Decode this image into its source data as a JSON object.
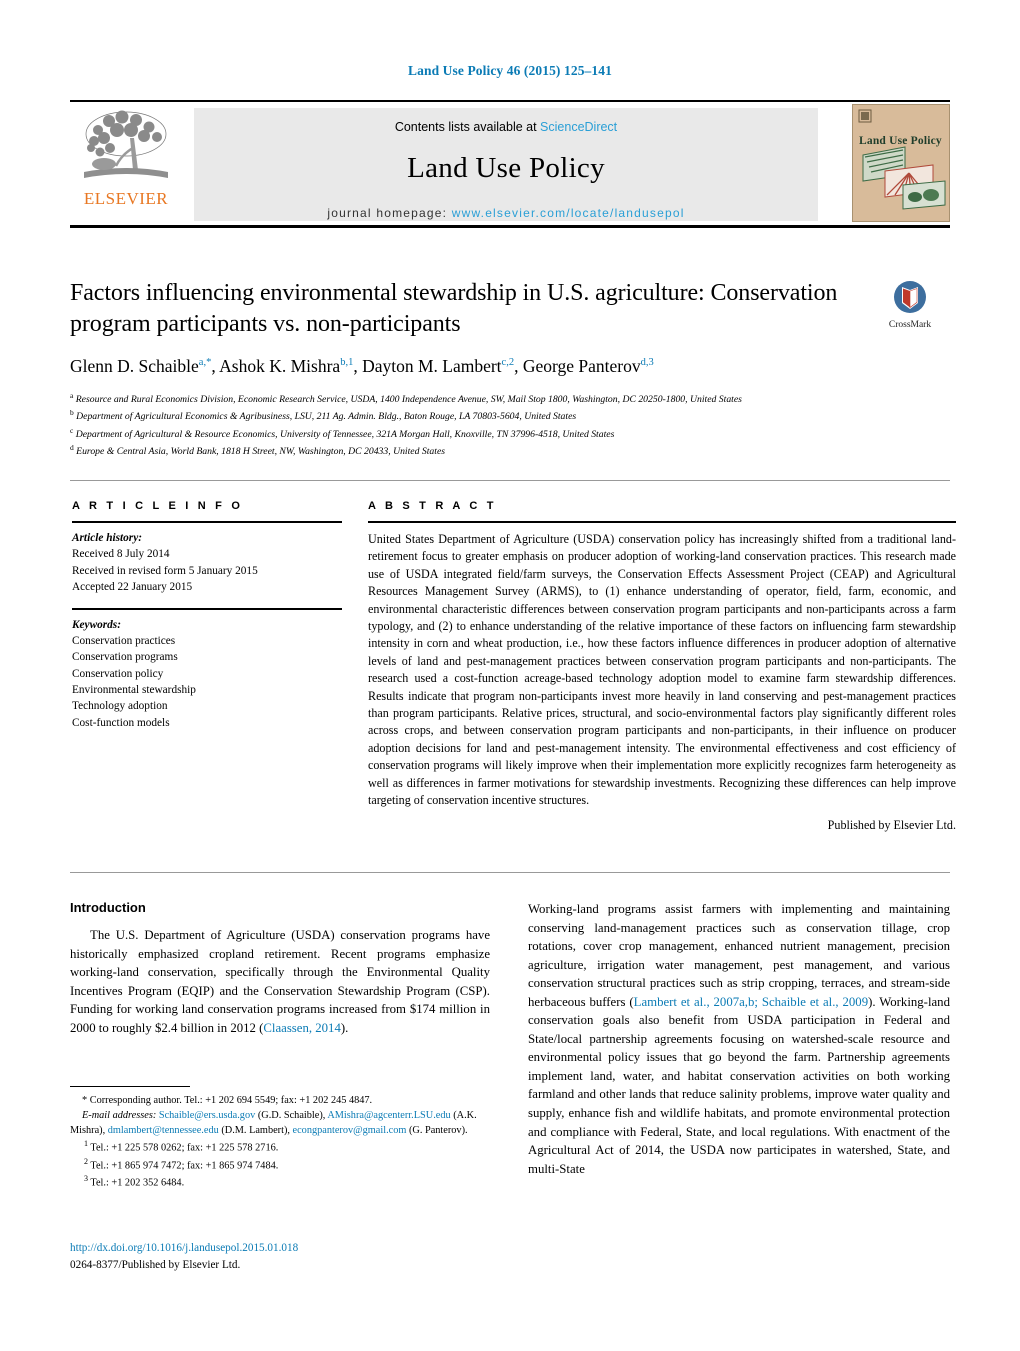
{
  "journal_ref": "Land Use Policy 46 (2015) 125–141",
  "masthead": {
    "contents_prefix": "Contents lists available at ",
    "sciencedirect": "ScienceDirect",
    "journal_title": "Land Use Policy",
    "homepage_prefix": "journal homepage:",
    "homepage_url": "www.elsevier.com/locate/landusepol",
    "publisher_wordmark": "ELSEVIER",
    "cover_title": "Land Use Policy"
  },
  "article": {
    "title": "Factors influencing environmental stewardship in U.S. agriculture: Conservation program participants vs. non-participants",
    "crossmark_label": "CrossMark",
    "authors": [
      {
        "name": "Glenn D. Schaible",
        "marks": "a,*"
      },
      {
        "name": "Ashok K. Mishra",
        "marks": "b,1"
      },
      {
        "name": "Dayton M. Lambert",
        "marks": "c,2"
      },
      {
        "name": "George Panterov",
        "marks": "d,3"
      }
    ],
    "affiliations": [
      {
        "mark": "a",
        "text": "Resource and Rural Economics Division, Economic Research Service, USDA, 1400 Independence Avenue, SW, Mail Stop 1800, Washington, DC 20250-1800, United States"
      },
      {
        "mark": "b",
        "text": "Department of Agricultural Economics & Agribusiness, LSU, 211 Ag. Admin. Bldg., Baton Rouge, LA 70803-5604, United States"
      },
      {
        "mark": "c",
        "text": "Department of Agricultural & Resource Economics, University of Tennessee, 321A Morgan Hall, Knoxville, TN 37996-4518, United States"
      },
      {
        "mark": "d",
        "text": "Europe & Central Asia, World Bank, 1818 H Street, NW, Washington, DC 20433, United States"
      }
    ]
  },
  "article_info": {
    "heading": "A R T I C L E   I N F O",
    "history_label": "Article history:",
    "history": [
      "Received 8 July 2014",
      "Received in revised form 5 January 2015",
      "Accepted 22 January 2015"
    ],
    "keywords_label": "Keywords:",
    "keywords": [
      "Conservation practices",
      "Conservation programs",
      "Conservation policy",
      "Environmental stewardship",
      "Technology adoption",
      "Cost-function models"
    ]
  },
  "abstract": {
    "heading": "A B S T R A C T",
    "text": "United States Department of Agriculture (USDA) conservation policy has increasingly shifted from a traditional land-retirement focus to greater emphasis on producer adoption of working-land conservation practices. This research made use of USDA integrated field/farm surveys, the Conservation Effects Assessment Project (CEAP) and Agricultural Resources Management Survey (ARMS), to (1) enhance understanding of operator, field, farm, economic, and environmental characteristic differences between conservation program participants and non-participants across a farm typology, and (2) to enhance understanding of the relative importance of these factors on influencing farm stewardship intensity in corn and wheat production, i.e., how these factors influence differences in producer adoption of alternative levels of land and pest-management practices between conservation program participants and non-participants. The research used a cost-function acreage-based technology adoption model to examine farm stewardship differences. Results indicate that program non-participants invest more heavily in land conserving and pest-management practices than program participants. Relative prices, structural, and socio-environmental factors play significantly different roles across crops, and between conservation program participants and non-participants, in their influence on producer adoption decisions for land and pest-management intensity. The environmental effectiveness and cost efficiency of conservation programs will likely improve when their implementation more explicitly recognizes farm heterogeneity as well as differences in farmer motivations for stewardship investments. Recognizing these differences can help improve targeting of conservation incentive structures.",
    "publisher_note": "Published by Elsevier Ltd."
  },
  "body": {
    "intro_heading": "Introduction",
    "left_paragraph_1": "The U.S. Department of Agriculture (USDA) conservation programs have historically emphasized cropland retirement. Recent programs emphasize working-land conservation, specifically through the Environmental Quality Incentives Program (EQIP) and the Conservation Stewardship Program (CSP). Funding for working land conservation programs increased from $174 million in 2000 to roughly $2.4 billion in 2012 (",
    "left_paragraph_1_cite": "Claassen, 2014",
    "left_paragraph_1_end": ").",
    "right_paragraph_1a": "Working-land programs assist farmers with implementing and maintaining conserving land-management practices such as conservation tillage, crop rotations, cover crop management, enhanced nutrient management, precision agriculture, irrigation water management, pest management, and various conservation structural practices such as strip cropping, terraces, and stream-side herbaceous buffers (",
    "right_paragraph_1_cite": "Lambert et al., 2007a,b; Schaible et al., 2009",
    "right_paragraph_1b": "). Working-land conservation goals also benefit from USDA participation in Federal and State/local partnership agreements focusing on watershed-scale resource and environmental policy issues that go beyond the farm. Partnership agreements implement land, water, and habitat conservation activities on both working farmland and other lands that reduce salinity problems, improve water quality and supply, enhance fish and wildlife habitats, and promote environmental protection and compliance with Federal, State, and local regulations. With enactment of the Agricultural Act of 2014, the USDA now participates in watershed, State, and multi-State"
  },
  "footnotes": {
    "corresponding": "* Corresponding author. Tel.: +1 202 694 5549; fax: +1 202 245 4847.",
    "email_label": "E-mail addresses:",
    "emails": [
      {
        "address": "Schaible@ers.usda.gov",
        "owner": "(G.D. Schaible),"
      },
      {
        "address": "AMishra@agcenterr.LSU.edu",
        "owner": "(A.K. Mishra),"
      },
      {
        "address": "dmlambert@tennessee.edu",
        "owner": "(D.M. Lambert),"
      },
      {
        "address": "econgpanterov@gmail.com",
        "owner": "(G. Panterov)."
      }
    ],
    "numbered": [
      {
        "num": "1",
        "text": "Tel.: +1 225 578 0262; fax: +1 225 578 2716."
      },
      {
        "num": "2",
        "text": "Tel.: +1 865 974 7472; fax: +1 865 974 7484."
      },
      {
        "num": "3",
        "text": "Tel.: +1 202 352 6484."
      }
    ]
  },
  "doi": {
    "url": "http://dx.doi.org/10.1016/j.landusepol.2015.01.018",
    "issn_line": "0264-8377/Published by Elsevier Ltd."
  },
  "colors": {
    "link_blue": "#0b7bb5",
    "sciencedirect_blue": "#2a9fd6",
    "elsevier_orange": "#e87722",
    "banner_gray": "#e9e9e9",
    "cover_tan": "#d8bb9a"
  }
}
